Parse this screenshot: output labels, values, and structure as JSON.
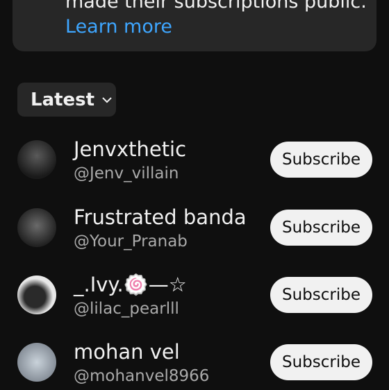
{
  "info_card": {
    "text": "made their subscriptions public.",
    "link_label": "Learn more"
  },
  "sort": {
    "selected": "Latest",
    "icon": "chevron-down-icon"
  },
  "channels": [
    {
      "name": "Jenvxthetic",
      "handle": "@Jenv_villain",
      "button_label": "Subscribe",
      "avatar_colors": [
        "#1a1a1a",
        "#5a5a5a"
      ]
    },
    {
      "name": "Frustrated banda",
      "handle": "@Your_Pranab",
      "button_label": "Subscribe",
      "avatar_colors": [
        "#222222",
        "#6a6a6a"
      ]
    },
    {
      "name": "_.Ivy.🍥—☆",
      "handle": "@lilac_pearlll",
      "button_label": "Subscribe",
      "avatar_colors": [
        "#e8e8e8",
        "#2a2a2a"
      ]
    },
    {
      "name": "mohan vel",
      "handle": "@mohanvel8966",
      "button_label": "Subscribe",
      "avatar_colors": [
        "#c9d2da",
        "#7e8690"
      ]
    }
  ],
  "colors": {
    "background": "#0f0f0f",
    "card": "#272727",
    "link": "#3ea6ff",
    "button_bg": "#f1f1f1",
    "secondary_text": "#aaaaaa"
  }
}
